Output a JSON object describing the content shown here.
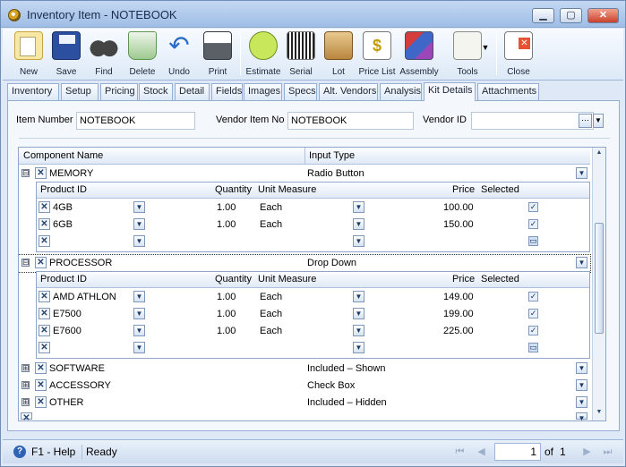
{
  "window": {
    "title": "Inventory Item - NOTEBOOK"
  },
  "toolbar": {
    "new": "New",
    "save": "Save",
    "find": "Find",
    "delete": "Delete",
    "undo": "Undo",
    "print": "Print",
    "estimate": "Estimate",
    "serial": "Serial",
    "lot": "Lot",
    "price_list": "Price List",
    "assembly": "Assembly",
    "tools": "Tools",
    "close": "Close"
  },
  "tabs": [
    "Inventory",
    "Setup",
    "Pricing",
    "Stock",
    "Detail",
    "Fields",
    "Images",
    "Specs",
    "Alt. Vendors",
    "Analysis",
    "Kit Details",
    "Attachments"
  ],
  "active_tab": "Kit Details",
  "form": {
    "item_number_label": "Item Number",
    "item_number": "NOTEBOOK",
    "vendor_item_no_label": "Vendor Item No",
    "vendor_item_no": "NOTEBOOK",
    "vendor_id_label": "Vendor ID",
    "vendor_id": ""
  },
  "grid": {
    "col_component": "Component Name",
    "col_input_type": "Input Type",
    "sub_cols": {
      "product_id": "Product ID",
      "quantity": "Quantity",
      "unit_measure": "Unit Measure",
      "price": "Price",
      "selected": "Selected"
    },
    "components": [
      {
        "name": "MEMORY",
        "input_type": "Radio Button",
        "expanded": "⊟",
        "items": [
          {
            "product": "4GB",
            "qty": "1.00",
            "uom": "Each",
            "price": "100.00"
          },
          {
            "product": "6GB",
            "qty": "1.00",
            "uom": "Each",
            "price": "150.00"
          },
          {
            "product": "",
            "qty": "",
            "uom": "",
            "price": ""
          }
        ]
      },
      {
        "name": "PROCESSOR",
        "input_type": "Drop Down",
        "expanded": "⊟",
        "items": [
          {
            "product": "AMD ATHLON",
            "qty": "1.00",
            "uom": "Each",
            "price": "149.00"
          },
          {
            "product": "E7500",
            "qty": "1.00",
            "uom": "Each",
            "price": "199.00"
          },
          {
            "product": "E7600",
            "qty": "1.00",
            "uom": "Each",
            "price": "225.00"
          },
          {
            "product": "",
            "qty": "",
            "uom": "",
            "price": ""
          }
        ]
      },
      {
        "name": "SOFTWARE",
        "input_type": "Included – Shown",
        "expanded": "⊞"
      },
      {
        "name": "ACCESSORY",
        "input_type": "Check Box",
        "expanded": "⊞"
      },
      {
        "name": "OTHER",
        "input_type": "Included – Hidden",
        "expanded": "⊞"
      }
    ]
  },
  "status": {
    "help": "F1 - Help",
    "state": "Ready",
    "page": "1",
    "of": "of",
    "total": "1"
  },
  "colors": {
    "accent": "#dfe8f6",
    "border": "#8fa6c8",
    "title": "#1b2e4c"
  }
}
